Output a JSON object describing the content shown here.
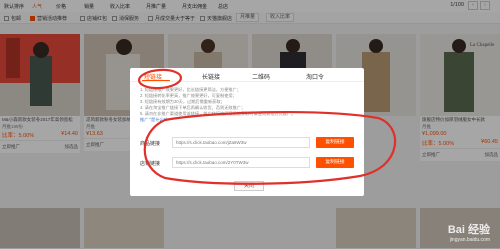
{
  "topbar": {
    "sort_default": "默认排序",
    "sort_popular": "人气",
    "sort_price": "价格",
    "sort_sales": "销量",
    "sort_income": "收入比率",
    "sort_commission": "月推广量",
    "sort_total": "月支出佣金",
    "sort_shop": "总店",
    "pager": "1/100"
  },
  "filters": {
    "items": [
      {
        "label": "包邮",
        "checked": false
      },
      {
        "label": "营销活动推荐",
        "checked": true
      },
      {
        "label": "店铺红包",
        "checked": false
      },
      {
        "label": "消保服务",
        "checked": false
      },
      {
        "label": "月成交量大于等于",
        "checked": false
      },
      {
        "label": "天猫旗舰店",
        "checked": false
      }
    ],
    "dropdown1": "月推量",
    "dropdown2": "收入比率"
  },
  "products": [
    {
      "title": "M&小森新款女装冬2017年高领宽松",
      "meta": "月推199份",
      "ratio": "比率：5.00%",
      "price": "¥14.40",
      "act1": "立即推广",
      "act2": "加选品"
    },
    {
      "title": "凉风新款秋冬女装加绒卫衣",
      "meta": "月推",
      "ratio": "比率：",
      "price": "¥",
      "act1": "立即推广",
      "act2": "加选品"
    },
    {
      "title": "",
      "meta": "",
      "ratio": "",
      "price": "",
      "act1": "",
      "act2": ""
    },
    {
      "title": "",
      "meta": "",
      "ratio": "",
      "price": "",
      "act1": "",
      "act2": ""
    },
    {
      "title": "",
      "meta": "",
      "ratio": "",
      "price": "",
      "act1": "",
      "act2": ""
    },
    {
      "title": "旗舰店特价加厚羽绒服女中长款",
      "meta": "月推",
      "ratio": "比率：5.00%",
      "price": "¥60.45",
      "act1": "立即推广",
      "act2": "加选品"
    }
  ],
  "partial_prices": {
    "left_price": "¥13.63",
    "right_price": "¥1,099.00"
  },
  "modal": {
    "tabs": [
      "短链接",
      "长链接",
      "二维码",
      "淘口令"
    ],
    "notes": [
      "1. 短链接推广效果更好，比长链接更简洁，方便推广；",
      "2. 短链接转化率更高，推广效果更好，可复制使用；",
      "3. 短链接有效期为30天，过期后需重新获取；",
      "4. 请在淘宝推广链接下单后再确认收货，否则无效推广；",
      "5. 请勿在非推广渠道使用该链接，推广链接被屏蔽无法获取时请使用其他方式推广。"
    ],
    "notes_link": "推广 \"是什么\"？",
    "row1_label": "商品链接",
    "row1_value": "https://s.click.taobao.com/jZa6W3w",
    "row2_label": "店铺链接",
    "row2_value": "https://s.click.taobao.com/2Y0TW3w",
    "copy_label": "复制链接",
    "close_label": "关闭"
  },
  "watermark": {
    "main": "Bai 经验",
    "sub": "jingyan.baidu.com"
  },
  "colors": {
    "accent": "#ff5000",
    "annotation": "#e0302a"
  }
}
